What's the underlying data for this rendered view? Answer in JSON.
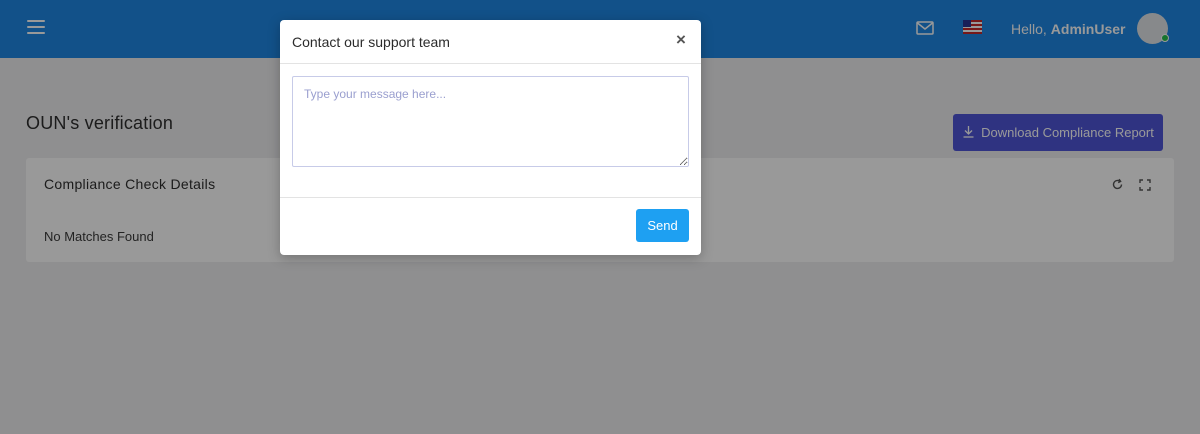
{
  "header": {
    "menu_icon": "hamburger-icon",
    "mail_icon": "mail-icon",
    "flag_icon": "us-flag-icon",
    "greeting": "Hello,",
    "username": "AdminUser",
    "accent_color": "#1e88e5"
  },
  "page": {
    "title": "OUN's verification",
    "download_button": "Download Compliance Report",
    "download_icon": "download-icon"
  },
  "card": {
    "title": "Compliance Check Details",
    "empty_text": "No Matches Found",
    "refresh_icon": "refresh-icon",
    "expand_icon": "fullscreen-icon"
  },
  "modal": {
    "title": "Contact our support team",
    "close_label": "×",
    "message_placeholder": "Type your message here...",
    "message_value": "",
    "send_label": "Send",
    "send_color": "#1ea0f2"
  }
}
